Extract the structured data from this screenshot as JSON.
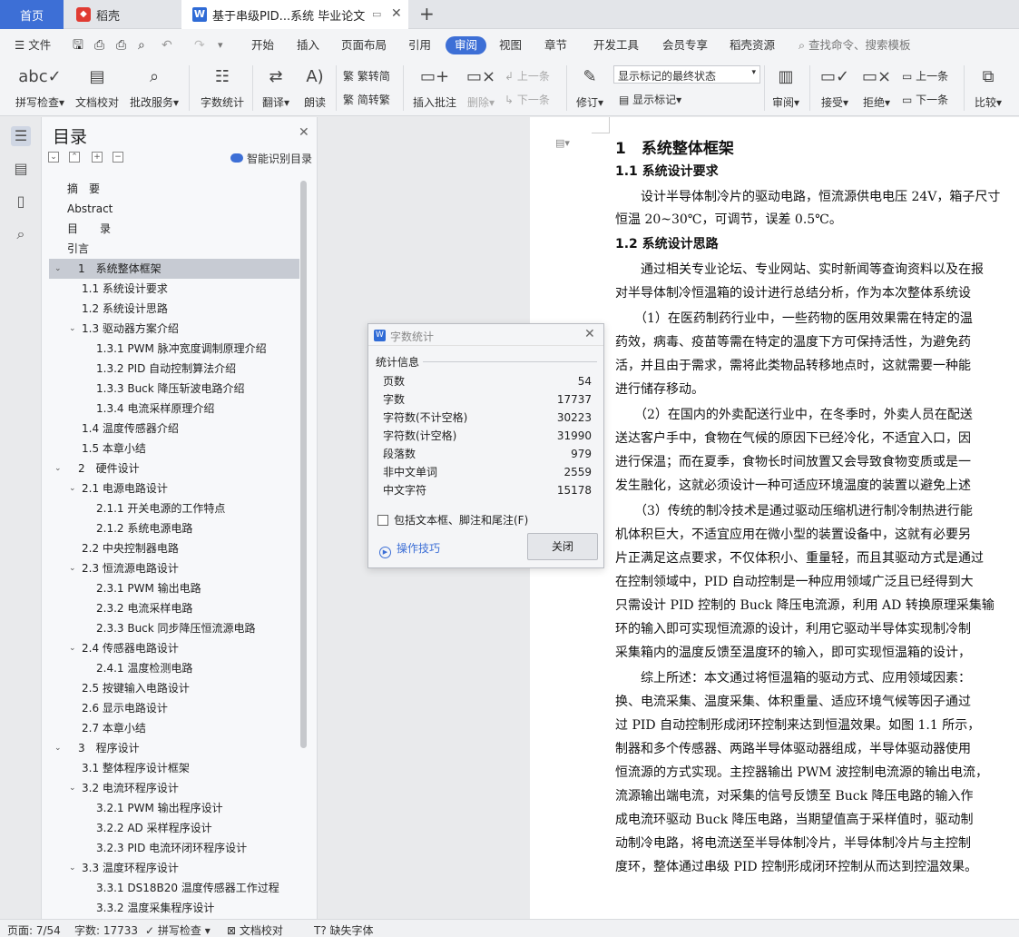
{
  "tabs": {
    "home": "首页",
    "daoke": "稻壳",
    "doc": "基于串级PID...系统 毕业论文",
    "doc_icon": "W",
    "new_tab": "+"
  },
  "menu": {
    "file": "文件",
    "items": [
      "开始",
      "插入",
      "页面布局",
      "引用",
      "审阅",
      "视图",
      "章节",
      "开发工具",
      "会员专享",
      "稻壳资源"
    ],
    "search": "查找命令、搜索模板"
  },
  "ribbon": {
    "spell": "拼写检查",
    "doc_proof": "文档校对",
    "annotate_service": "批改服务",
    "word_count": "字数统计",
    "translate": "翻译",
    "read": "朗读",
    "to_trad": "繁转简",
    "to_simp": "简转繁",
    "insert_comment": "插入批注",
    "delete": "删除",
    "prev1": "上一条",
    "next1": "下一条",
    "revise": "修订",
    "show_mode": "显示标记的最终状态",
    "show_marks": "显示标记",
    "review": "审阅",
    "accept": "接受",
    "reject": "拒绝",
    "prev2": "上一条",
    "next2": "下一条",
    "compare": "比较"
  },
  "toc": {
    "title": "目录",
    "smart": "智能识别目录",
    "items": [
      "摘　要",
      "Abstract",
      "目　　录",
      "引言",
      "1　系统整体框架",
      "1.1  系统设计要求",
      "1.2  系统设计思路",
      "1.3  驱动器方案介绍",
      "1.3.1 PWM 脉冲宽度调制原理介绍",
      "1.3.2 PID 自动控制算法介绍",
      "1.3.3 Buck 降压斩波电路介绍",
      "1.3.4 电流采样原理介绍",
      "1.4  温度传感器介绍",
      "1.5  本章小结",
      "2　硬件设计",
      "2.1  电源电路设计",
      "2.1.1 开关电源的工作特点",
      "2.1.2 系统电源电路",
      "2.2  中央控制器电路",
      "2.3  恒流源电路设计",
      "2.3.1 PWM 输出电路",
      "2.3.2 电流采样电路",
      "2.3.3 Buck 同步降压恒流源电路",
      "2.4  传感器电路设计",
      "2.4.1 温度检测电路",
      "2.5  按键输入电路设计",
      "2.6  显示电路设计",
      "2.7  本章小结",
      "3　程序设计",
      "3.1  整体程序设计框架",
      "3.2  电流环程序设计",
      "3.2.1 PWM 输出程序设计",
      "3.2.2 AD 采样程序设计",
      "3.2.3 PID 电流环闭环程序设计",
      "3.3  温度环程序设计",
      "3.3.1 DS18B20 温度传感器工作过程",
      "3.3.2 温度采集程序设计"
    ]
  },
  "doc": {
    "lines": [
      "1　系统整体框架",
      "1.1  系统设计要求",
      "　　设计半导体制冷片的驱动电路，恒流源供电电压 24V，箱子尺寸",
      "恒温 20~30℃，可调节，误差 0.5℃。",
      "1.2  系统设计思路",
      "　　通过相关专业论坛、专业网站、实时新闻等查询资料以及在报",
      "对半导体制冷恒温箱的设计进行总结分析，作为本次整体系统设",
      "　　（1）在医药制药行业中，一些药物的医用效果需在特定的温",
      "药效，病毒、疫苗等需在特定的温度下方可保持活性，为避免药",
      "活，并且由于需求，需将此类物品转移地点时，这就需要一种能",
      "进行储存移动。",
      "　　（2）在国内的外卖配送行业中，在冬季时，外卖人员在配送",
      "送达客户手中，食物在气候的原因下已经冷化，不适宜入口，因",
      "进行保温；而在夏季，食物长时间放置又会导致食物变质或是一",
      "发生融化，这就必须设计一种可适应环境温度的装置以避免上述",
      "　　（3）传统的制冷技术是通过驱动压缩机进行制冷制热进行能",
      "机体积巨大，不适宜应用在微小型的装置设备中，这就有必要另",
      "片正满足这点要求，不仅体积小、重量轻，而且其驱动方式是通过",
      "在控制领域中，PID 自动控制是一种应用领域广泛且已经得到大",
      "只需设计 PID 控制的 Buck 降压电流源，利用 AD 转换原理采集输",
      "环的输入即可实现恒流源的设计，利用它驱动半导体实现制冷制",
      "采集箱内的温度反馈至温度环的输入，即可实现恒温箱的设计，",
      "　　综上所述：本文通过将恒温箱的驱动方式、应用领域因素：",
      "换、电流采集、温度采集、体积重量、适应环境气候等因子通过",
      "过 PID 自动控制形成闭环控制来达到恒温效果。如图 1.1 所示，",
      "制器和多个传感器、两路半导体驱动器组成，半导体驱动器使用",
      "恒流源的方式实现。主控器输出 PWM 波控制电流源的输出电流，",
      "流源输出端电流，对采集的信号反馈至 Buck 降压电路的输入作",
      "成电流环驱动 Buck 降压电路，当期望值高于采样值时，驱动制",
      "动制冷电路，将电流送至半导体制冷片，半导体制冷片与主控制",
      "度环，整体通过串级 PID 控制形成闭环控制从而达到控温效果。"
    ]
  },
  "dialog": {
    "title": "字数统计",
    "section": "统计信息",
    "rows": [
      {
        "label": "页数",
        "value": "54"
      },
      {
        "label": "字数",
        "value": "17737"
      },
      {
        "label": "字符数(不计空格)",
        "value": "30223"
      },
      {
        "label": "字符数(计空格)",
        "value": "31990"
      },
      {
        "label": "段落数",
        "value": "979"
      },
      {
        "label": "非中文单词",
        "value": "2559"
      },
      {
        "label": "中文字符",
        "value": "15178"
      }
    ],
    "include": "包括文本框、脚注和尾注(F)",
    "tips": "操作技巧",
    "close": "关闭"
  },
  "status": {
    "page": "页面: 7/54",
    "words": "字数: 17733",
    "spell": "拼写检查",
    "proof": "文档校对",
    "missing_font": "缺失字体"
  }
}
